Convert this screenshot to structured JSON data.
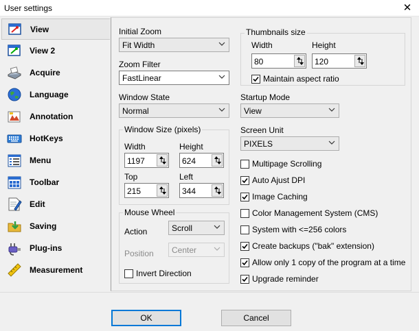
{
  "window": {
    "title": "User settings",
    "close_glyph": "✕"
  },
  "sidebar": {
    "items": [
      {
        "label": "View",
        "icon": "view-icon",
        "selected": true
      },
      {
        "label": "View 2",
        "icon": "view2-icon"
      },
      {
        "label": "Acquire",
        "icon": "scanner-icon"
      },
      {
        "label": "Language",
        "icon": "globe-icon"
      },
      {
        "label": "Annotation",
        "icon": "annotation-icon"
      },
      {
        "label": "HotKeys",
        "icon": "keyboard-icon"
      },
      {
        "label": "Menu",
        "icon": "menu-icon"
      },
      {
        "label": "Toolbar",
        "icon": "toolbar-icon"
      },
      {
        "label": "Edit",
        "icon": "edit-icon"
      },
      {
        "label": "Saving",
        "icon": "saving-icon"
      },
      {
        "label": "Plug-ins",
        "icon": "plugin-icon"
      },
      {
        "label": "Measurement",
        "icon": "ruler-icon"
      }
    ]
  },
  "view": {
    "initial_zoom": {
      "label": "Initial Zoom",
      "value": "Fit Width"
    },
    "zoom_filter": {
      "label": "Zoom Filter",
      "value": "FastLinear"
    },
    "window_state": {
      "label": "Window State",
      "value": "Normal"
    },
    "window_size": {
      "title": "Window Size (pixels)",
      "width_label": "Width",
      "width": "1197",
      "height_label": "Height",
      "height": "624",
      "top_label": "Top",
      "top": "215",
      "left_label": "Left",
      "left": "344"
    },
    "mouse_wheel": {
      "title": "Mouse Wheel",
      "action_label": "Action",
      "action": "Scroll",
      "position_label": "Position",
      "position": "Center",
      "invert_label": "Invert Direction",
      "invert": false
    },
    "thumbnails": {
      "title": "Thumbnails size",
      "width_label": "Width",
      "width": "80",
      "height_label": "Height",
      "height": "120",
      "aspect_label": "Maintain aspect ratio",
      "aspect": true
    },
    "startup_mode": {
      "label": "Startup Mode",
      "value": "View"
    },
    "screen_unit": {
      "label": "Screen Unit",
      "value": "PIXELS"
    },
    "options": [
      {
        "label": "Multipage Scrolling",
        "checked": false
      },
      {
        "label": "Auto Ajust DPI",
        "checked": true
      },
      {
        "label": "Image Caching",
        "checked": true
      },
      {
        "label": "Color Management System (CMS)",
        "checked": false
      },
      {
        "label": "System with <=256 colors",
        "checked": false
      },
      {
        "label": "Create backups (\"bak\" extension)",
        "checked": true
      },
      {
        "label": "Allow only 1 copy of the program at a time",
        "checked": true
      },
      {
        "label": "Upgrade reminder",
        "checked": true
      }
    ]
  },
  "buttons": {
    "ok": "OK",
    "cancel": "Cancel"
  },
  "colors": {
    "accent": "#0078d7",
    "panel_bg": "#f0f0f0"
  }
}
